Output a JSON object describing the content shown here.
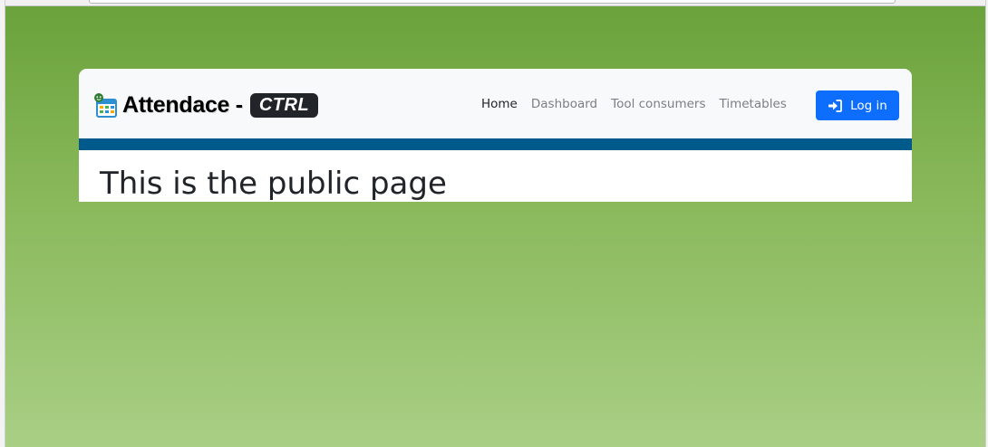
{
  "brand": {
    "name": "Attendace -",
    "badge": "CTRL",
    "icon": "calendar-icon"
  },
  "nav": {
    "items": [
      {
        "label": "Home",
        "active": true
      },
      {
        "label": "Dashboard",
        "active": false
      },
      {
        "label": "Tool consumers",
        "active": false
      },
      {
        "label": "Timetables",
        "active": false
      }
    ]
  },
  "login": {
    "label": "Log in",
    "icon": "sign-in-icon"
  },
  "main": {
    "title": "This is the public page"
  },
  "colors": {
    "navbar_bg": "#f8f9fa",
    "stripe": "#005a8c",
    "button": "#0d6efd",
    "badge": "#212529",
    "gradient_top": "#6aa23b",
    "gradient_bottom": "#a9cf85"
  }
}
